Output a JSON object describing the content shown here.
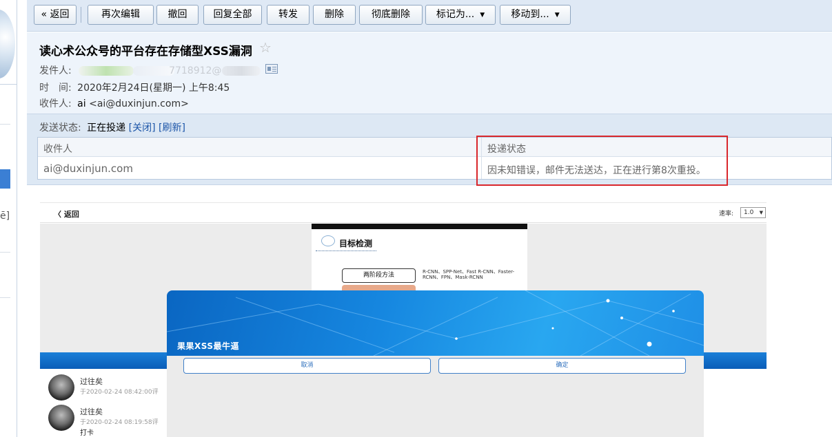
{
  "toolbar": {
    "back": "« 返回",
    "reedit": "再次编辑",
    "withdraw": "撤回",
    "reply_all": "回复全部",
    "forward": "转发",
    "delete": "删除",
    "delete_permanently": "彻底删除",
    "mark_as": "标记为...",
    "move_to": "移动到..."
  },
  "email": {
    "subject": "读心术公众号的平台存在存储型XSS漏洞",
    "from_label": "发件人:",
    "from_visible": "7718912@",
    "time_label": "时　间:",
    "time_value": "2020年2月24日(星期一) 上午8:45",
    "to_label": "收件人:",
    "to_name": "ai",
    "to_addr": "<ai@duxinjun.com>"
  },
  "delivery": {
    "label": "发送状态:",
    "value": "正在投递",
    "close": "[关闭]",
    "refresh": "[刷新]",
    "col_recipient": "收件人",
    "col_status": "投递状态",
    "recipient": "ai@duxinjun.com",
    "status_text": "因未知错误，邮件无法送达，正在进行第8次重投。"
  },
  "screenshot": {
    "back": "返回",
    "rate_label": "速率:",
    "rate_value": "1.0",
    "slide_title": "目标检测",
    "slide_method": "两阶段方法",
    "slide_note": "R-CNN、SPP-Net、Fast R-CNN、Faster-RCNN、FPN、Mask-RCNN",
    "comments": [
      {
        "name": "过往矣",
        "time": "于2020-02-24 08:42:00评",
        "text": ""
      },
      {
        "name": "过往矣",
        "time": "于2020-02-24 08:19:58评",
        "text": "打卡"
      }
    ]
  },
  "dialog": {
    "title": "果果XSS最牛逼",
    "cancel": "取消",
    "confirm": "确定"
  },
  "left_nav": {
    "fragment": "ē]"
  }
}
